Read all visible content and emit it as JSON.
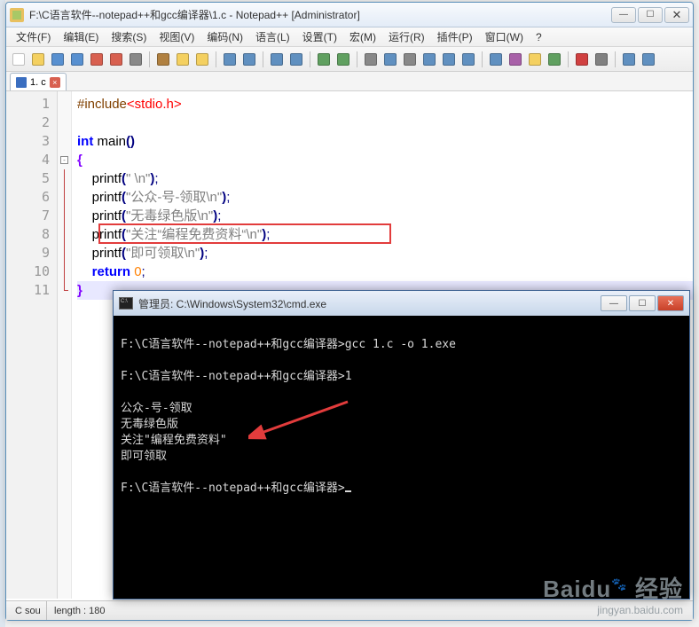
{
  "window": {
    "title": "F:\\C语言软件--notepad++和gcc编译器\\1.c - Notepad++ [Administrator]",
    "min": "—",
    "max": "☐",
    "close": "✕"
  },
  "menu": {
    "file": "文件(F)",
    "edit": "编辑(E)",
    "search": "搜索(S)",
    "view": "视图(V)",
    "encoding": "编码(N)",
    "language": "语言(L)",
    "settings": "设置(T)",
    "macro": "宏(M)",
    "run": "运行(R)",
    "plugins": "插件(P)",
    "window": "窗口(W)",
    "help": "?"
  },
  "toolbar_icons": [
    "new",
    "open",
    "save",
    "save-all",
    "close",
    "close-all",
    "print",
    "sep",
    "cut",
    "copy",
    "paste",
    "sep",
    "undo",
    "redo",
    "sep",
    "find",
    "replace",
    "sep",
    "zoom-in",
    "zoom-out",
    "sep",
    "sync",
    "word-wrap",
    "show-all",
    "indent-guide",
    "fold",
    "unfold",
    "sep",
    "doc-map",
    "fn-list",
    "folder",
    "monitor",
    "sep",
    "record",
    "play",
    "sep",
    "play-fwd",
    "play-back"
  ],
  "tab": {
    "label": "1. c",
    "close": "×"
  },
  "code": {
    "lines": [
      {
        "n": 1,
        "html": "<span class='pp'>#include</span><span class='sysh'>&lt;stdio.h&gt;</span>"
      },
      {
        "n": 2,
        "html": ""
      },
      {
        "n": 3,
        "html": "<span class='kw'>int</span> <span class='fn'>main</span><span class='paren'>()</span>"
      },
      {
        "n": 4,
        "html": "<span class='brace'>{</span>"
      },
      {
        "n": 5,
        "html": "    <span class='fn'>printf</span><span class='paren'>(</span><span class='str'>\" \\n\"</span><span class='paren'>)</span><span class='semi'>;</span>"
      },
      {
        "n": 6,
        "html": "    <span class='fn'>printf</span><span class='paren'>(</span><span class='str'>\"公众-号-领取\\n\"</span><span class='paren'>)</span><span class='semi'>;</span>"
      },
      {
        "n": 7,
        "html": "    <span class='fn'>printf</span><span class='paren'>(</span><span class='str'>\"无毒绿色版\\n\"</span><span class='paren'>)</span><span class='semi'>;</span>"
      },
      {
        "n": 8,
        "html": "    <span class='fn'>printf</span><span class='paren'>(</span><span class='str'>\"关注“编程免费资料“\\n\"</span><span class='paren'>)</span><span class='semi'>;</span>"
      },
      {
        "n": 9,
        "html": "    <span class='fn'>printf</span><span class='paren'>(</span><span class='str'>\"即可领取\\n\"</span><span class='paren'>)</span><span class='semi'>;</span>"
      },
      {
        "n": 10,
        "html": "    <span class='kw'>return</span> <span class='num'>0</span><span class='semi'>;</span>"
      },
      {
        "n": 11,
        "html": "<span class='brace'>}</span>"
      }
    ],
    "highlight_line": 8,
    "current_line": 11
  },
  "statusbar": {
    "seg1": "C sou",
    "seg2": "length : 180"
  },
  "cmd": {
    "title": "管理员: C:\\Windows\\System32\\cmd.exe",
    "min": "—",
    "max": "☐",
    "close": "✕",
    "lines": [
      "",
      "F:\\C语言软件--notepad++和gcc编译器>gcc 1.c -o 1.exe",
      "",
      "F:\\C语言软件--notepad++和gcc编译器>1",
      "",
      "公众-号-领取",
      "无毒绿色版",
      "关注\"编程免费资料\"",
      "即可领取",
      "",
      "F:\\C语言软件--notepad++和gcc编译器>"
    ]
  },
  "watermark": {
    "brand": "Baidu",
    "suffix": "经验",
    "url": "jingyan.baidu.com"
  }
}
